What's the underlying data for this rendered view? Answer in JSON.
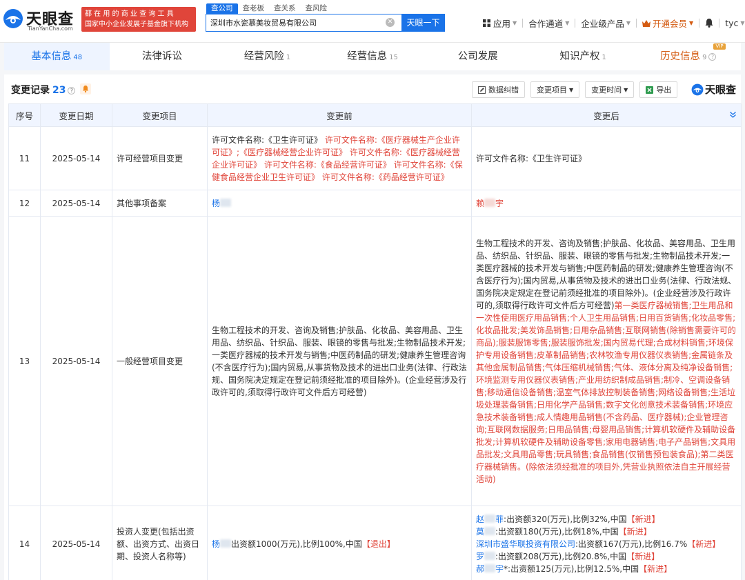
{
  "header": {
    "logo_cn": "天眼查",
    "logo_en": "TianYanCha.com",
    "slogan_line1": "都 在 用 的 商 业 查 询 工 具",
    "slogan_line2": "国家中小企业发展子基金旗下机构",
    "search_tabs": [
      "查公司",
      "查老板",
      "查关系",
      "查风险"
    ],
    "search_value": "深圳市水瓷慕美妆贸易有限公司",
    "search_button": "天眼一下",
    "nav": {
      "apps": "应用",
      "partner": "合作通道",
      "enterprise": "企业级产品",
      "member": "开通会员",
      "user": "tyc"
    }
  },
  "main_tabs": [
    {
      "label": "基本信息",
      "count": "48"
    },
    {
      "label": "法律诉讼",
      "count": ""
    },
    {
      "label": "经营风险",
      "count": "1"
    },
    {
      "label": "经营信息",
      "count": "15"
    },
    {
      "label": "公司发展",
      "count": ""
    },
    {
      "label": "知识产权",
      "count": "1"
    },
    {
      "label": "历史信息",
      "count": "9",
      "badge": "VIP"
    }
  ],
  "section": {
    "title": "变更记录",
    "count": "23",
    "toolbar": {
      "correct": "数据纠错",
      "filter_item": "变更项目",
      "filter_time": "变更时间",
      "export": "导出"
    },
    "brand": "天眼查"
  },
  "table": {
    "headers": [
      "序号",
      "变更日期",
      "变更项目",
      "变更前",
      "变更后"
    ],
    "rows": [
      {
        "no": "11",
        "date": "2025-05-14",
        "item": "许可经营项目变更",
        "before_normal": "许可文件名称:《卫生许可证》",
        "before_red": "许可文件名称:《医疗器械生产企业许可证》;《医疗器械经营企业许可证》 许可文件名称:《医疗器械经营企业许可证》 许可文件名称:《食品经营许可证》 许可文件名称:《保健食品经营企业卫生许可证》 许可文件名称:《药品经营许可证》",
        "after": "许可文件名称:《卫生许可证》"
      },
      {
        "no": "12",
        "date": "2025-05-14",
        "item": "其他事项备案",
        "before_name": "杨",
        "after_name_a": "赖",
        "after_name_b": "宇"
      },
      {
        "no": "13",
        "date": "2025-05-14",
        "item": "一般经营项目变更",
        "before": "生物工程技术的开发、咨询及销售;护肤品、化妆品、美容用品、卫生用品、纺织品、针织品、服装、眼镜的零售与批发;生物制品技术开发;一类医疗器械的技术开发与销售;中医药制品的研发;健康养生管理咨询(不含医疗行为);国内贸易,从事货物及技术的进出口业务(法律、行政法规、国务院决定规定在登记前须经批准的项目除外)。(企业经营涉及行政许可的,须取得行政许可文件后方可经营)",
        "after_normal": "生物工程技术的开发、咨询及销售;护肤品、化妆品、美容用品、卫生用品、纺织品、针织品、服装、眼镜的零售与批发;生物制品技术开发;一类医疗器械的技术开发与销售;中医药制品的研发;健康养生管理咨询(不含医疗行为);国内贸易,从事货物及技术的进出口业务(法律、行政法规、国务院决定规定在登记前须经批准的项目除外)。(企业经营涉及行政许可的,须取得行政许可文件后方可经营)",
        "after_red": "第一类医疗器械销售;卫生用品和一次性使用医疗用品销售;个人卫生用品销售;日用百货销售;化妆品零售;化妆品批发;美发饰品销售;日用杂品销售;互联网销售(除销售需要许可的商品);服装服饰零售;服装服饰批发;国内贸易代理;合成材料销售;环境保护专用设备销售;皮革制品销售;农林牧渔专用仪器仪表销售;金属链条及其他金属制品销售;气体压缩机械销售;气体、液体分离及纯净设备销售;环境监测专用仪器仪表销售;产业用纺织制成品销售;制冷、空调设备销售;移动通信设备销售;温室气体排放控制装备销售;网络设备销售;生活垃圾处理装备销售;日用化学产品销售;数字文化创意技术装备销售;环境应急技术装备销售;成人情趣用品销售(不含药品、医疗器械);企业管理咨询;互联网数据服务;日用品销售;母婴用品销售;计算机软硬件及辅助设备批发;计算机软硬件及辅助设备零售;家用电器销售;电子产品销售;文具用品批发;文具用品零售;玩具销售;食品销售(仅销售预包装食品);第二类医疗器械销售。(除依法须经批准的项目外,凭营业执照依法自主开展经营活动)"
      },
      {
        "no": "14",
        "date": "2025-05-14",
        "item": "投资人变更(包括出资额、出资方式、出资日期、投资人名称等)",
        "before": {
          "name": "杨",
          "detail": "出资额1000(万元),比例100%,中国",
          "tag": "【退出】"
        },
        "after": [
          {
            "name": "赵",
            "name_tail": "菲",
            "detail": ":出资额320(万元),比例32%,中国",
            "tag": "【新进】"
          },
          {
            "name": "莫",
            "name_tail": "",
            "detail": ":出资额180(万元),比例18%,中国",
            "tag": "【新进】"
          },
          {
            "name": "深圳市盛华联投资有限公司",
            "name_tail": "",
            "detail": ":出资额167(万元),比例16.7%",
            "tag": "【新进】"
          },
          {
            "name": "罗",
            "name_tail": "",
            "detail": ":出资额208(万元),比例20.8%,中国",
            "tag": "【新进】"
          },
          {
            "name": "郝",
            "name_tail": "宇",
            "detail": "*:出资额125(万元),比例12.5%,中国",
            "tag": "【新进】"
          }
        ]
      }
    ]
  }
}
